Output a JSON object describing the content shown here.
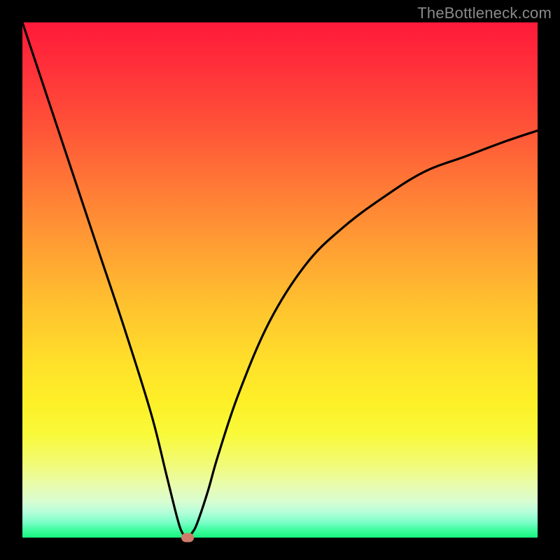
{
  "watermark": "TheBottleneck.com",
  "chart_data": {
    "type": "line",
    "title": "",
    "xlabel": "",
    "ylabel": "",
    "xlim": [
      0,
      100
    ],
    "ylim": [
      0,
      100
    ],
    "grid": false,
    "legend": false,
    "series": [
      {
        "name": "bottleneck-curve",
        "x": [
          0,
          5,
          10,
          15,
          20,
          25,
          28,
          30,
          31,
          32,
          33,
          34,
          36,
          38,
          42,
          48,
          55,
          62,
          70,
          78,
          86,
          94,
          100
        ],
        "y": [
          100,
          85,
          70,
          55,
          40,
          24,
          12,
          4,
          1,
          0,
          1,
          3,
          9,
          16,
          28,
          42,
          53,
          60,
          66,
          71,
          74,
          77,
          79
        ]
      }
    ],
    "marker": {
      "x": 32,
      "y": 0,
      "color": "#cf7b6a"
    },
    "background_gradient": {
      "top": "#ff1a3a",
      "mid": "#ffe02a",
      "bottom": "#17f57e"
    }
  }
}
